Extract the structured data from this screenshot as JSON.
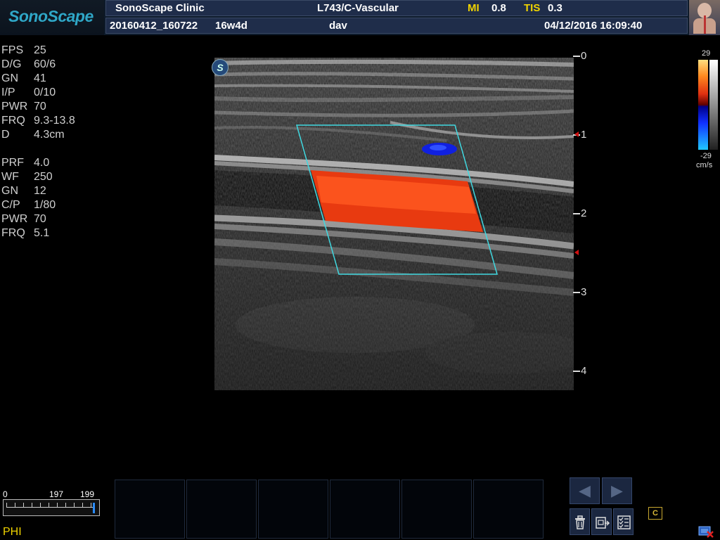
{
  "header": {
    "brand": "SonoScape",
    "clinic": "SonoScape Clinic",
    "probe_preset": "L743/C-Vascular",
    "mi_label": "MI",
    "mi_value": "0.8",
    "tis_label": "TIS",
    "tis_value": "0.3",
    "patient_id": "20160412_160722",
    "gestational_age": "16w4d",
    "operator": "dav",
    "datetime": "04/12/2016 16:09:40"
  },
  "bmode_params": [
    {
      "name": "FPS",
      "value": "25"
    },
    {
      "name": "D/G",
      "value": "60/6"
    },
    {
      "name": "GN",
      "value": "41"
    },
    {
      "name": "I/P",
      "value": "0/10"
    },
    {
      "name": "PWR",
      "value": "70"
    },
    {
      "name": "FRQ",
      "value": "9.3-13.8"
    },
    {
      "name": "D",
      "value": "4.3cm"
    }
  ],
  "color_params": [
    {
      "name": "PRF",
      "value": "4.0"
    },
    {
      "name": "WF",
      "value": "250"
    },
    {
      "name": "GN",
      "value": "12"
    },
    {
      "name": "C/P",
      "value": "1/80"
    },
    {
      "name": "PWR",
      "value": "70"
    },
    {
      "name": "FRQ",
      "value": "5.1"
    }
  ],
  "image_badge": "S",
  "depth_scale": [
    "0",
    "1",
    "2",
    "3",
    "4"
  ],
  "color_bar": {
    "max": "29",
    "min": "-29",
    "unit": "cm/s"
  },
  "slider": {
    "min": "0",
    "current": "197",
    "max": "199",
    "fill_fraction": 0.99
  },
  "slider_label": "PHI",
  "cine_label": "C",
  "icons": {
    "prev": "chevron-left-icon",
    "next": "chevron-right-icon",
    "delete": "trash-icon",
    "export": "export-icon",
    "checklist": "checklist-icon",
    "cine": "cine-icon",
    "usb": "usb-device-icon"
  },
  "colors": {
    "accent": "#2fa7c7",
    "highlight": "#f0d400",
    "header": "#1f2d4a",
    "roi": "#40d8e0"
  }
}
